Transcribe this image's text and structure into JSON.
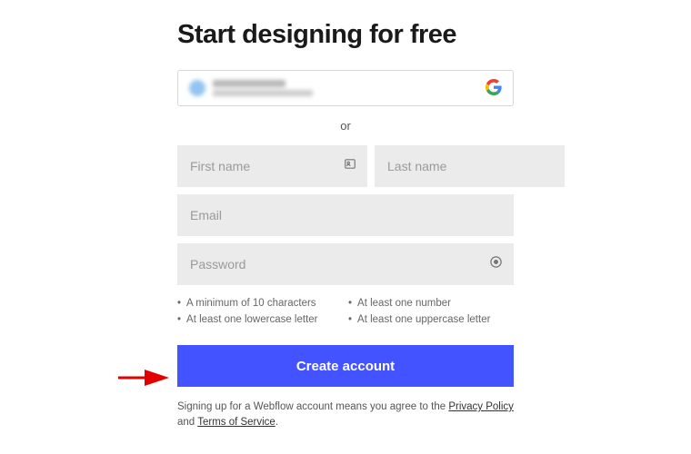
{
  "title": "Start designing for free",
  "divider_text": "or",
  "fields": {
    "first_name_placeholder": "First name",
    "last_name_placeholder": "Last name",
    "email_placeholder": "Email",
    "password_placeholder": "Password"
  },
  "password_hints": [
    "A minimum of 10 characters",
    "At least one number",
    "At least one lowercase letter",
    "At least one uppercase letter"
  ],
  "create_button": "Create account",
  "legal": {
    "prefix": "Signing up for a Webflow account means you agree to the ",
    "privacy": "Privacy Policy",
    "and": " and ",
    "terms": "Terms of Service",
    "suffix": "."
  },
  "colors": {
    "primary": "#4353ff"
  }
}
